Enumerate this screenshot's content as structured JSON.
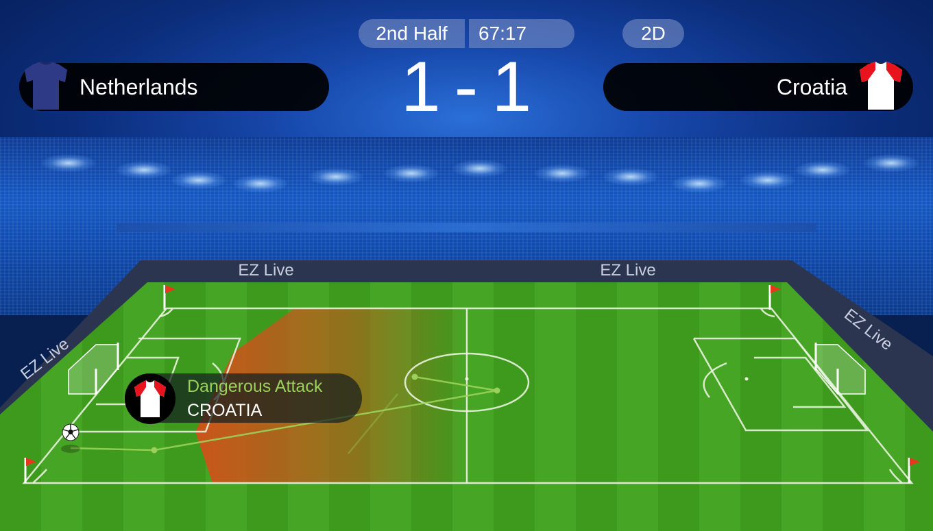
{
  "header": {
    "period": "2nd Half",
    "clock": "67:17",
    "view_mode": "2D",
    "score": {
      "home": "1",
      "separator": "-",
      "away": "1"
    }
  },
  "teams": {
    "home": {
      "name": "Netherlands",
      "shirt_color": "#2e3a86"
    },
    "away": {
      "name": "Croatia",
      "shirt_color": "#ffffff",
      "shirt_accent": "#e8141d"
    }
  },
  "boards": [
    "EZ Live",
    "EZ Live",
    "EZ Live",
    "EZ Live"
  ],
  "event": {
    "type": "Dangerous Attack",
    "team": "CROATIA"
  },
  "colors": {
    "pitch_green": "#3f9a1f",
    "attack_zone": "#d2531a",
    "event_accent": "#9ad15a"
  }
}
